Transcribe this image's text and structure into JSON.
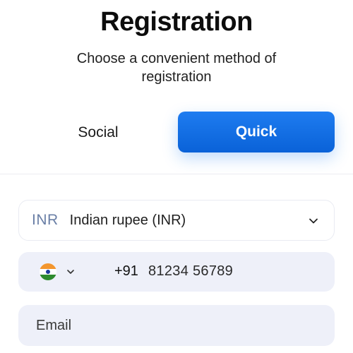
{
  "header": {
    "title": "Registration",
    "subtitle": "Choose a convenient method of registration"
  },
  "tabs": {
    "social_label": "Social",
    "quick_label": "Quick",
    "active": "Quick",
    "active_color": "#1e7cf0"
  },
  "currency": {
    "code": "INR",
    "name": "Indian rupee (INR)",
    "icon": "chevron-down-icon"
  },
  "phone": {
    "country_flag": "india-flag-icon",
    "dial_code": "+91",
    "number": "81234 56789"
  },
  "email": {
    "placeholder": "Email"
  }
}
